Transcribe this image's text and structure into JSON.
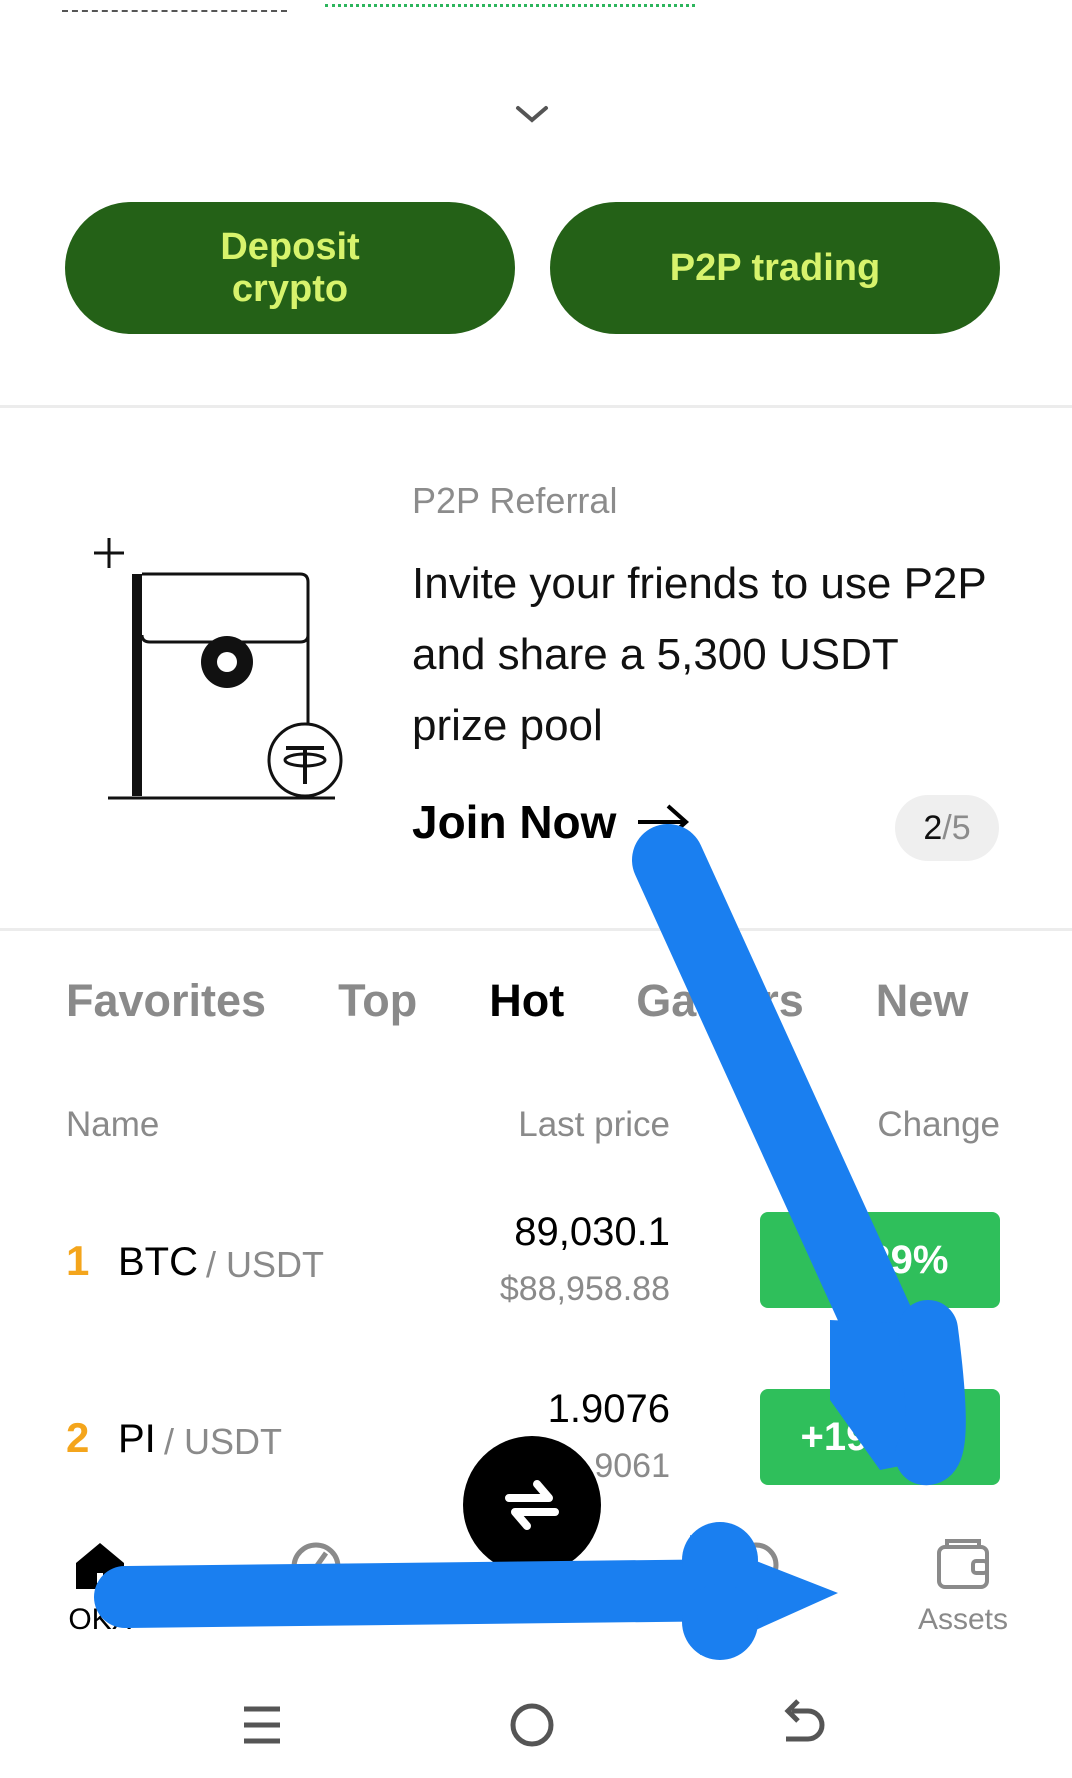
{
  "actions": {
    "deposit_label": "Deposit crypto",
    "p2p_label": "P2P trading"
  },
  "referral": {
    "kicker": "P2P Referral",
    "headline": "Invite your friends to use P2P and share a 5,300 USDT prize pool",
    "cta": "Join Now",
    "page_current": "2",
    "page_total": "/5"
  },
  "market_tabs": [
    {
      "label": "Favorites",
      "active": false
    },
    {
      "label": "Top",
      "active": false
    },
    {
      "label": "Hot",
      "active": true
    },
    {
      "label": "Gainers",
      "active": false
    },
    {
      "label": "New",
      "active": false
    }
  ],
  "columns": {
    "name": "Name",
    "last_price": "Last price",
    "change": "Change"
  },
  "rows": [
    {
      "rank": "1",
      "symbol": "BTC",
      "quote": "/ USDT",
      "price": "89,030.1",
      "price_usd": "$88,958.88",
      "change": "+0.39%"
    },
    {
      "rank": "2",
      "symbol": "PI",
      "quote": "/ USDT",
      "price": "1.9076",
      "price_usd": "$1.9061",
      "change": "+19.66%"
    }
  ],
  "bottom_nav": [
    {
      "label": "OKX",
      "icon": "home-icon",
      "active": true
    },
    {
      "label": "",
      "icon": "markets-icon",
      "active": false
    },
    {
      "label": "",
      "icon": "trade-swap-icon",
      "active": false
    },
    {
      "label": "",
      "icon": "explore-icon",
      "active": false
    },
    {
      "label": "Assets",
      "icon": "wallet-icon",
      "active": false
    }
  ],
  "colors": {
    "brand_green_dark": "#246117",
    "brand_lime": "#d7f36c",
    "gain_green": "#2fbf5b",
    "rank_orange": "#f4a51c",
    "annotation_blue": "#1a7ff0"
  }
}
